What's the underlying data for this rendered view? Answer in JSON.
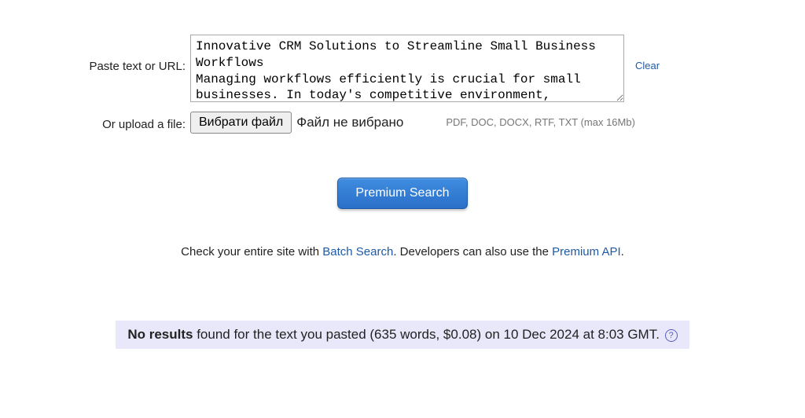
{
  "form": {
    "paste_label": "Paste text or URL:",
    "textarea_value": "Innovative CRM Solutions to Streamline Small Business Workflows\nManaging workflows efficiently is crucial for small businesses. In today's competitive environment,",
    "clear_label": "Clear",
    "upload_label": "Or upload a file:",
    "file_button": "Вибрати файл",
    "no_file_text": "Файл не вибрано",
    "file_hint": "PDF, DOC, DOCX, RTF, TXT (max 16Mb)",
    "search_button": "Premium Search"
  },
  "info": {
    "prefix": "Check your entire site with ",
    "batch_link": "Batch Search",
    "middle": ". Developers can also use the ",
    "api_link": "Premium API",
    "suffix": "."
  },
  "results": {
    "strong": "No results",
    "rest": " found for the text you pasted (635 words, $0.08) on 10 Dec 2024 at 8:03 GMT. ",
    "help_glyph": "?"
  }
}
